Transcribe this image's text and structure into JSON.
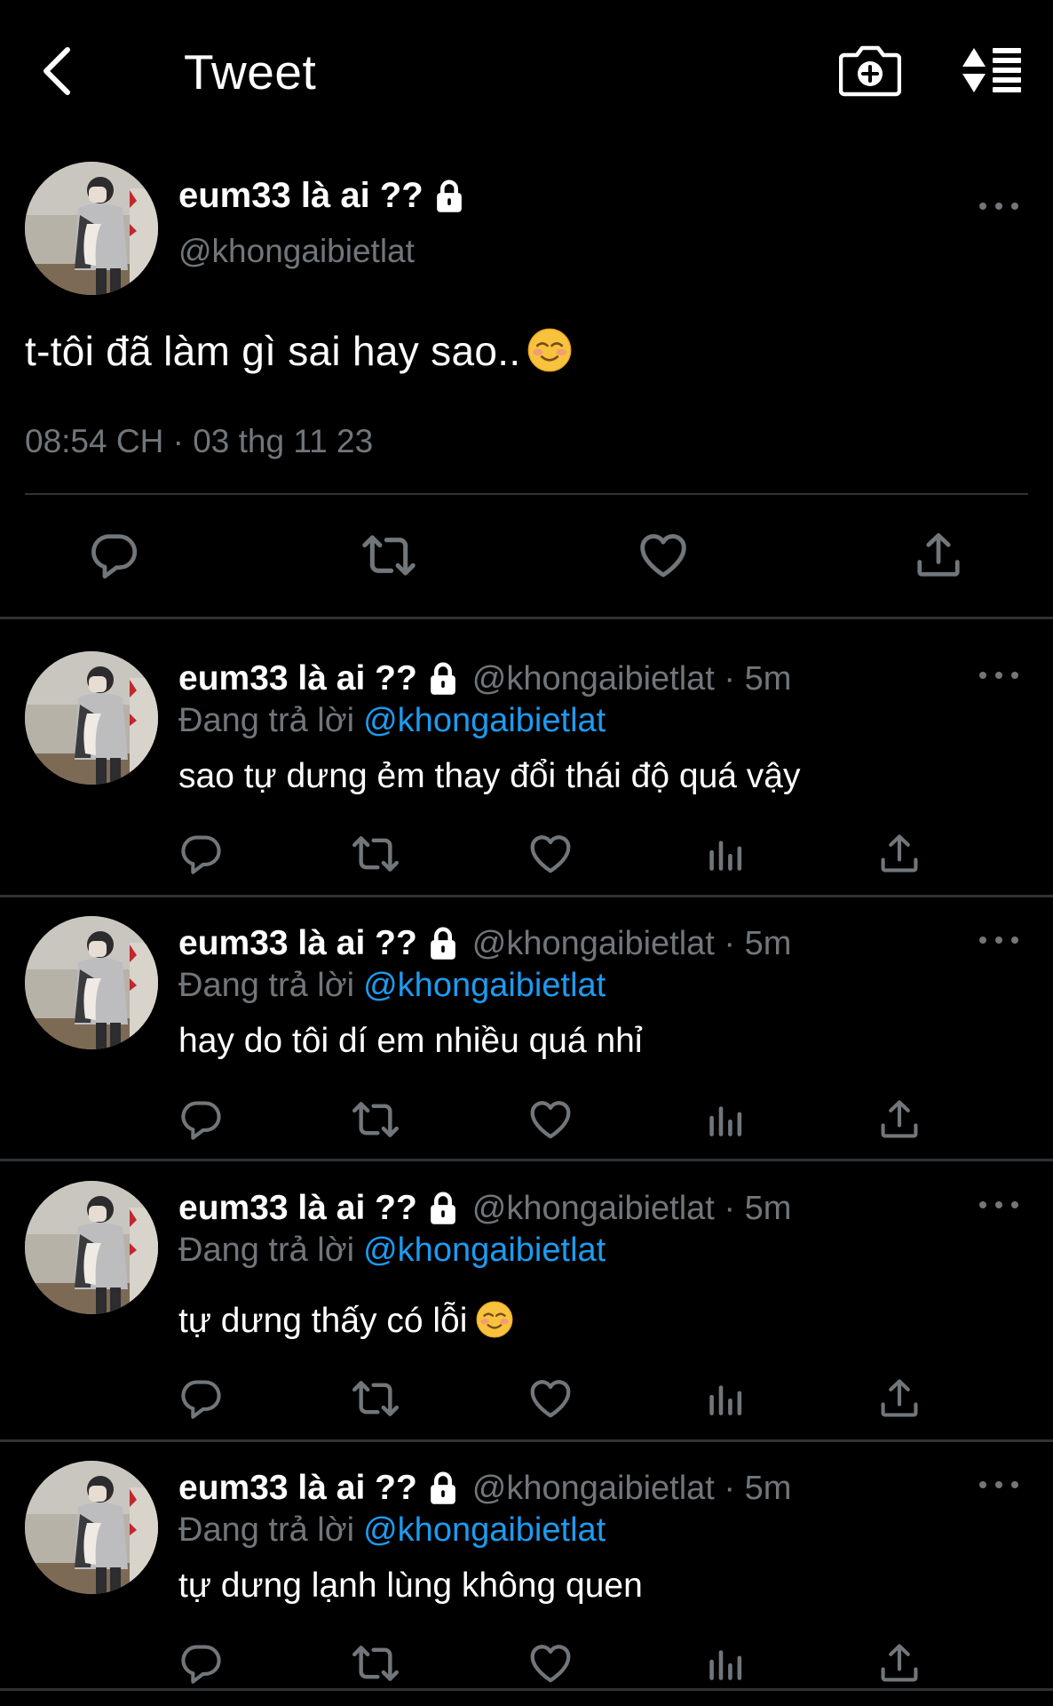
{
  "header": {
    "title": "Tweet",
    "back_icon": "back-arrow-icon",
    "camera_icon": "camera-add-icon",
    "sort_icon": "sort-icon"
  },
  "main_tweet": {
    "author_name": "eum33 là ai ??",
    "handle": "@khongaibietlat",
    "text": "t-tôi đã làm gì sai hay sao..",
    "timestamp": "08:54 CH · 03 thg 11 23"
  },
  "replies": [
    {
      "author_name": "eum33 là ai ??",
      "handle_time": "@khongaibietlat · 5m",
      "replying_label": "Đang trả lời",
      "replying_to": "@khongaibietlat",
      "text": "sao tự dưng ẻm thay đổi thái độ quá vậy"
    },
    {
      "author_name": "eum33 là ai ??",
      "handle_time": "@khongaibietlat · 5m",
      "replying_label": "Đang trả lời",
      "replying_to": "@khongaibietlat",
      "text": "hay do tôi dí em nhiều quá nhỉ"
    },
    {
      "author_name": "eum33 là ai ??",
      "handle_time": "@khongaibietlat · 5m",
      "replying_label": "Đang trả lời",
      "replying_to": "@khongaibietlat",
      "text": "tự dưng thấy có lỗi"
    },
    {
      "author_name": "eum33 là ai ??",
      "handle_time": "@khongaibietlat · 5m",
      "replying_label": "Đang trả lời",
      "replying_to": "@khongaibietlat",
      "text": "tự dưng lạnh lùng không quen"
    }
  ],
  "colors": {
    "background": "#000000",
    "text_primary": "#ffffff",
    "text_secondary": "#71767b",
    "link": "#1d9bf0",
    "divider": "#2f3336"
  }
}
